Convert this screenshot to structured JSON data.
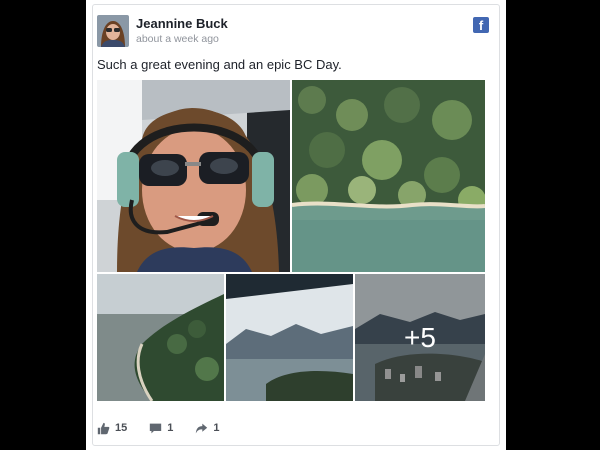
{
  "post": {
    "author": "Jeannine Buck",
    "timestamp": "about a week ago",
    "message": "Such a great evening and an epic BC Day.",
    "network_icon": "facebook-icon",
    "more_photos_label": "+5"
  },
  "stats": {
    "likes": "15",
    "comments": "1",
    "shares": "1"
  },
  "colors": {
    "facebook_blue": "#4267b2",
    "name_text": "#1d2129",
    "meta_text": "#90949c"
  }
}
